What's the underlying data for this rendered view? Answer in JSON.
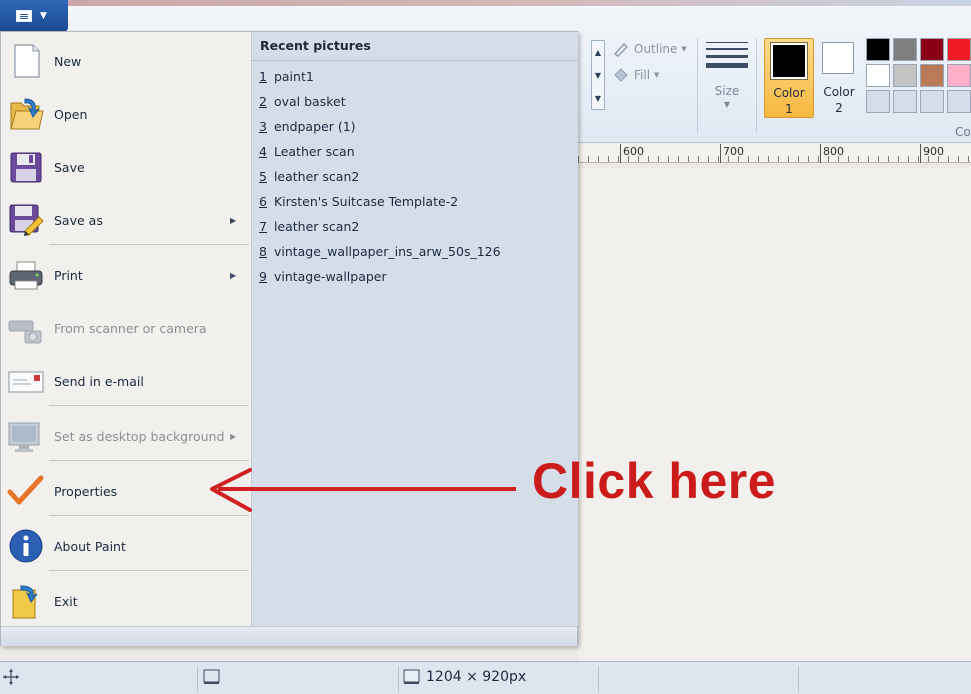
{
  "app_menu": {
    "items": [
      {
        "label": "New",
        "mnemonic": "N",
        "icon": "new-document-icon"
      },
      {
        "label": "Open",
        "mnemonic": "O",
        "icon": "open-folder-icon"
      },
      {
        "label": "Save",
        "mnemonic": "S",
        "icon": "floppy-disk-icon"
      },
      {
        "label": "Save as",
        "mnemonic": "A",
        "icon": "save-as-icon",
        "has_submenu": true
      },
      {
        "label": "Print",
        "mnemonic": "P",
        "icon": "printer-icon",
        "has_submenu": true
      },
      {
        "label": "From scanner or camera",
        "mnemonic": "m",
        "icon": "scanner-icon",
        "disabled": true
      },
      {
        "label": "Send in e-mail",
        "mnemonic": "d",
        "icon": "email-icon"
      },
      {
        "label": "Set as desktop background",
        "mnemonic": "b",
        "icon": "desktop-icon",
        "disabled": true,
        "has_submenu": true
      },
      {
        "label": "Properties",
        "mnemonic": "e",
        "icon": "checkmark-icon"
      },
      {
        "label": "About Paint",
        "mnemonic": "t",
        "icon": "info-icon"
      },
      {
        "label": "Exit",
        "mnemonic": "x",
        "icon": "exit-icon"
      }
    ]
  },
  "recent": {
    "title": "Recent pictures",
    "items": [
      {
        "num": "1",
        "name": "paint1"
      },
      {
        "num": "2",
        "name": "oval basket"
      },
      {
        "num": "3",
        "name": "endpaper (1)"
      },
      {
        "num": "4",
        "name": "Leather scan"
      },
      {
        "num": "5",
        "name": "leather scan2"
      },
      {
        "num": "6",
        "name": "Kirsten's Suitcase Template-2"
      },
      {
        "num": "7",
        "name": "leather scan2"
      },
      {
        "num": "8",
        "name": "vintage_wallpaper_ins_arw_50s_126"
      },
      {
        "num": "9",
        "name": "vintage-wallpaper"
      }
    ]
  },
  "ribbon": {
    "outline_label": "Outline",
    "fill_label": "Fill",
    "size_label": "Size",
    "color1_label": "Color\n1",
    "color1_line1": "Color",
    "color1_line2": "1",
    "color2_line1": "Color",
    "color2_line2": "2",
    "colors_group_label_cut": "Co",
    "palette": [
      "#000000",
      "#7f7f7f",
      "#880015",
      "#ed1c24",
      "#ffffff",
      "#c3c3c3",
      "#b97a57",
      "#ffaec9",
      "#d4dde8",
      "#d4dde8",
      "#d4dde8",
      "#d4dde8"
    ],
    "color1_value": "#000000",
    "color2_value": "#ffffff"
  },
  "ruler": {
    "labels": [
      "600",
      "700",
      "800",
      "900"
    ]
  },
  "status_bar": {
    "image_size": "1204 × 920px"
  },
  "annotation": {
    "text": "Click here",
    "color": "#cc1b1b"
  }
}
